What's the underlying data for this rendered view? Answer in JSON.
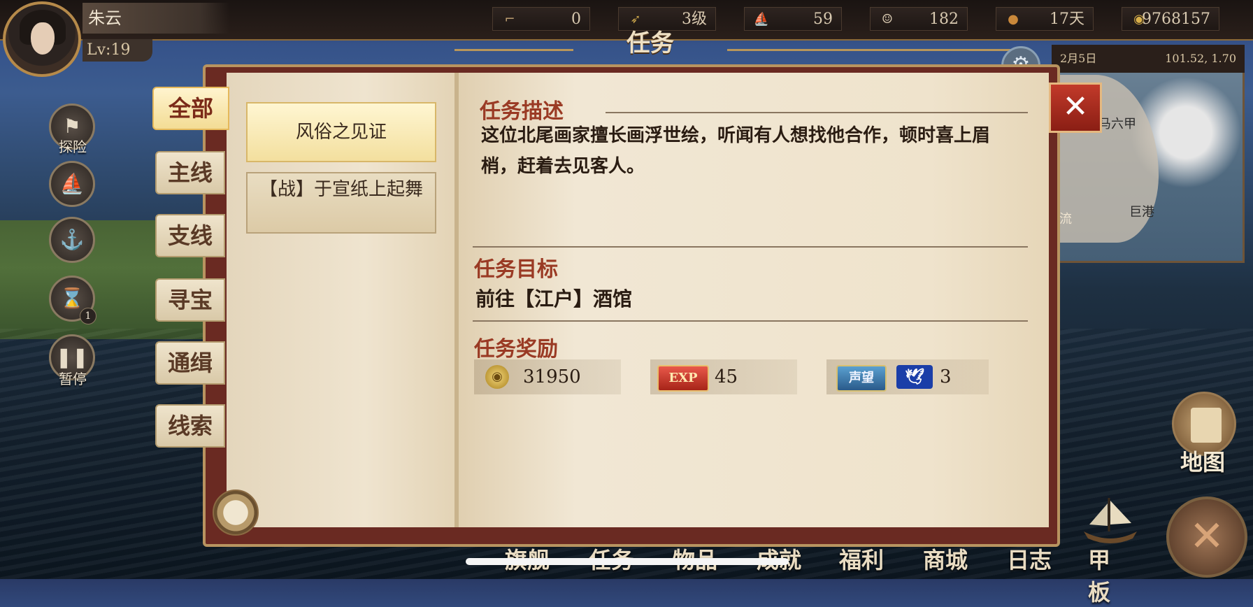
{
  "player": {
    "name": "朱云",
    "level": "Lv:19"
  },
  "resources": [
    {
      "icon": "boot-icon",
      "value": "0"
    },
    {
      "icon": "arrow-rank-icon",
      "value": "3级"
    },
    {
      "icon": "ship-crew-icon",
      "value": "59"
    },
    {
      "icon": "sailor-icon",
      "value": "182"
    },
    {
      "icon": "bread-icon",
      "value": "17天"
    },
    {
      "icon": "coin-icon",
      "value": "9768157"
    }
  ],
  "window_title": "任务",
  "minimap": {
    "date": "2月5日",
    "coords": "101.52, 1.70",
    "labels": [
      "马六甲",
      "巨港",
      "流"
    ]
  },
  "side_buttons": {
    "explore": "探险",
    "pause": "暂停",
    "hourglass_badge": "1"
  },
  "categories": [
    "全部",
    "主线",
    "支线",
    "寻宝",
    "通缉",
    "线索"
  ],
  "quests": [
    "风俗之见证",
    "【战】于宣纸上起舞"
  ],
  "detail": {
    "desc_title": "任务描述",
    "desc_text": "这位北尾画家擅长画浮世绘，听闻有人想找他合作，顿时喜上眉梢，赶着去见客人。",
    "goal_title": "任务目标",
    "goal_text": "前往【江户】酒馆",
    "reward_title": "任务奖励",
    "rewards": {
      "gold": "31950",
      "exp_badge": "EXP",
      "exp": "45",
      "fame_badge": "声望",
      "fame": "3"
    }
  },
  "close_label": "✕",
  "bottom_nav": [
    "旗舰",
    "任务",
    "物品",
    "成就",
    "福利",
    "商城",
    "日志",
    "甲板"
  ],
  "map_label": "地图",
  "colors": {
    "accent": "#9a3a24",
    "frame": "#6a2a22",
    "close": "#c23a2a"
  }
}
